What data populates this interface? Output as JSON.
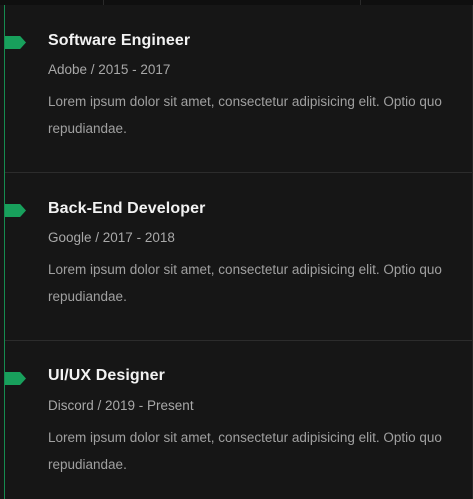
{
  "experience": {
    "items": [
      {
        "title": "Software Engineer",
        "meta": "Adobe / 2015 - 2017",
        "description": "Lorem ipsum dolor sit amet, consectetur adipisicing elit. Optio quo repudiandae."
      },
      {
        "title": "Back-End Developer",
        "meta": "Google / 2017 - 2018",
        "description": "Lorem ipsum dolor sit amet, consectetur adipisicing elit. Optio quo repudiandae."
      },
      {
        "title": "UI/UX Designer",
        "meta": "Discord / 2019 - Present",
        "description": "Lorem ipsum dolor sit amet, consectetur adipisicing elit. Optio quo repudiandae."
      }
    ]
  },
  "colors": {
    "accent": "#18a05c",
    "background": "#161616",
    "title": "#f2f2f2",
    "muted": "#a0a0a0"
  }
}
